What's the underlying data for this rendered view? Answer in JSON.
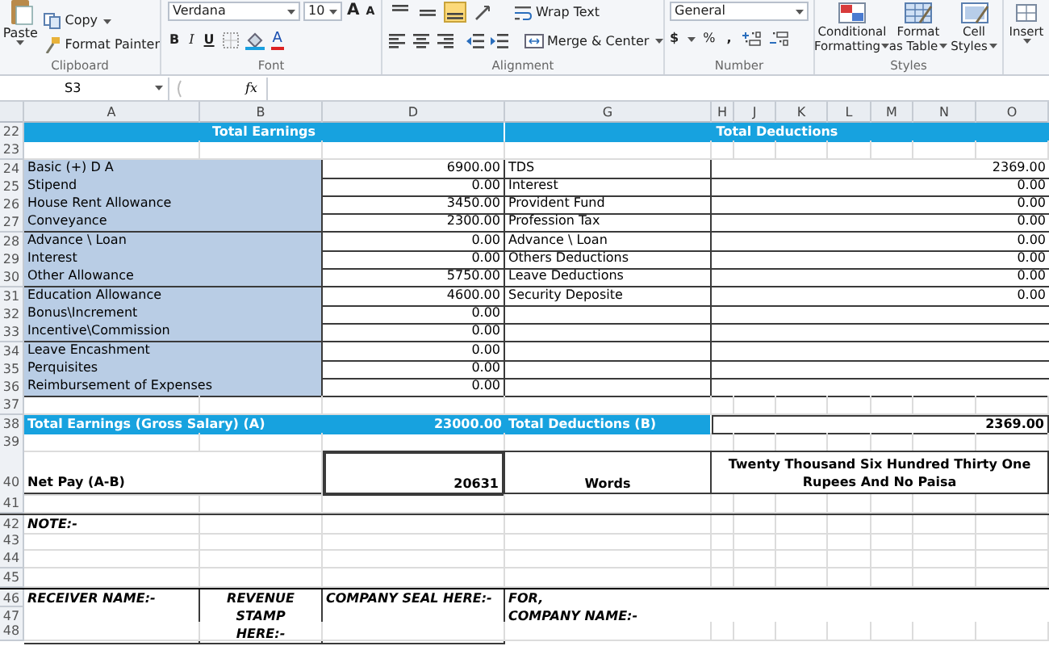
{
  "ribbon": {
    "clipboard": {
      "paste": "Paste",
      "copy": "Copy",
      "format_painter": "Format Painter",
      "label": "Clipboard"
    },
    "font": {
      "font_name": "Verdana",
      "font_size": "10",
      "grow_font": "A",
      "shrink_font": "A",
      "bold": "B",
      "italic": "I",
      "underline": "U",
      "font_color": "A",
      "label": "Font"
    },
    "alignment": {
      "vertical_align": [
        {
          "selected": false
        },
        {
          "selected": false
        },
        {
          "selected": true
        }
      ],
      "wrap_text": "Wrap Text",
      "merge_center": "Merge & Center",
      "label": "Alignment"
    },
    "number": {
      "format": "General",
      "currency": "$",
      "percent": "%",
      "comma": ",",
      "label": "Number"
    },
    "styles": {
      "buttons": [
        {
          "line1": "Conditional",
          "line2": "Formatting"
        },
        {
          "line1": "Format",
          "line2": "as Table"
        },
        {
          "line1": "Cell",
          "line2": "Styles"
        }
      ],
      "label": "Styles"
    },
    "cells": {
      "insert": "Insert"
    }
  },
  "formula_bar": {
    "name_box": "S3",
    "function_label": "fx"
  },
  "columns": [
    "A",
    "B",
    "D",
    "G",
    "H",
    "J",
    "K",
    "L",
    "M",
    "N",
    "O"
  ],
  "rows": [
    {
      "number": "22",
      "kind": "section_header",
      "left": "Total Earnings",
      "right": "Total Deductions"
    },
    {
      "number": "23",
      "kind": "blank"
    },
    {
      "number": "24",
      "kind": "item",
      "earning": "Basic (+) D A",
      "earning_amount": "6900.00",
      "deduction": "TDS",
      "deduction_amount": "2369.00"
    },
    {
      "number": "25",
      "kind": "item",
      "earning": "Stipend",
      "earning_amount": "0.00",
      "deduction": "Interest",
      "deduction_amount": "0.00"
    },
    {
      "number": "26",
      "kind": "item",
      "earning": "House Rent Allowance",
      "earning_amount": "3450.00",
      "deduction": "Provident Fund",
      "deduction_amount": "0.00"
    },
    {
      "number": "27",
      "kind": "item",
      "earning": "Conveyance",
      "earning_amount": "2300.00",
      "deduction": "Profession Tax",
      "deduction_amount": "0.00"
    },
    {
      "number": "28",
      "kind": "item",
      "earning": "Advance \\ Loan",
      "earning_amount": "0.00",
      "deduction": "Advance \\ Loan",
      "deduction_amount": "0.00"
    },
    {
      "number": "29",
      "kind": "item",
      "earning": "Interest",
      "earning_amount": "0.00",
      "deduction": "Others Deductions",
      "deduction_amount": "0.00"
    },
    {
      "number": "30",
      "kind": "item",
      "earning": "Other Allowance",
      "earning_amount": "5750.00",
      "deduction": "Leave Deductions",
      "deduction_amount": "0.00"
    },
    {
      "number": "31",
      "kind": "item",
      "earning": "Education Allowance",
      "earning_amount": "4600.00",
      "deduction": "Security Deposite",
      "deduction_amount": "0.00"
    },
    {
      "number": "32",
      "kind": "item",
      "earning": "Bonus\\Increment",
      "earning_amount": "0.00"
    },
    {
      "number": "33",
      "kind": "item",
      "earning": "Incentive\\Commission",
      "earning_amount": "0.00"
    },
    {
      "number": "34",
      "kind": "item",
      "earning": "Leave Encashment",
      "earning_amount": "0.00"
    },
    {
      "number": "35",
      "kind": "item",
      "earning": "Perquisites",
      "earning_amount": "0.00"
    },
    {
      "number": "36",
      "kind": "item",
      "earning": "Reimbursement of Expenses",
      "earning_amount": "0.00"
    },
    {
      "number": "37",
      "kind": "blank"
    },
    {
      "number": "38",
      "kind": "total",
      "earning_label": "Total Earnings (Gross Salary) (A)",
      "earning_total": "23000.00",
      "deduction_label": "Total Deductions (B)",
      "deduction_total": "2369.00"
    },
    {
      "number": "39",
      "kind": "blank"
    },
    {
      "number": "40",
      "kind": "net_pay",
      "label": "Net Pay (A-B)",
      "amount": "20631",
      "words_label": "Words",
      "words": "Twenty Thousand Six Hundred Thirty One Rupees And No Paisa"
    },
    {
      "number": "41",
      "kind": "blank"
    },
    {
      "number": "42",
      "kind": "note",
      "text": "NOTE:-"
    },
    {
      "number": "43",
      "kind": "blank"
    },
    {
      "number": "44",
      "kind": "blank"
    },
    {
      "number": "45",
      "kind": "blank"
    },
    {
      "numbers": [
        "46",
        "47"
      ],
      "kind": "signature",
      "receiver": "RECEIVER NAME:-",
      "stamp": "REVENUE STAMP HERE:-",
      "seal": "COMPANY SEAL HERE:-",
      "for": "FOR,",
      "company": "COMPANY NAME:-"
    },
    {
      "number": "48",
      "kind": "blank"
    }
  ]
}
